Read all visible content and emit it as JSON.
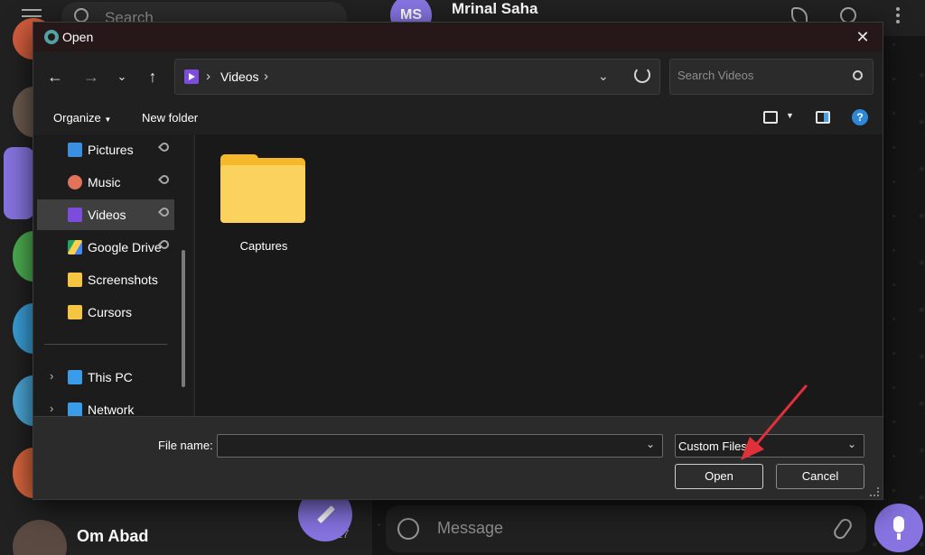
{
  "background_app": {
    "search_placeholder": "Search",
    "contact_initials": "MS",
    "contact_name": "Mrinal Saha",
    "last_chat_name": "Om Abad",
    "last_chat_count": "17",
    "message_placeholder": "Message",
    "accent_color": "#8774e1"
  },
  "dialog": {
    "title": "Open",
    "breadcrumb": [
      "Videos"
    ],
    "search_placeholder": "Search Videos",
    "commands": {
      "organize": "Organize",
      "new_folder": "New folder"
    },
    "help_glyph": "?",
    "sidebar": {
      "items": [
        {
          "label": "Pictures",
          "icon": "pictures-icon",
          "pinned": true
        },
        {
          "label": "Music",
          "icon": "music-icon",
          "pinned": true
        },
        {
          "label": "Videos",
          "icon": "videos-icon",
          "pinned": true,
          "selected": true
        },
        {
          "label": "Google Drive",
          "icon": "google-drive-icon",
          "pinned": true
        },
        {
          "label": "Screenshots",
          "icon": "folder-icon",
          "pinned": false
        },
        {
          "label": "Cursors",
          "icon": "folder-icon",
          "pinned": false
        },
        {
          "label": "This PC",
          "icon": "this-pc-icon",
          "expandable": true
        },
        {
          "label": "Network",
          "icon": "network-icon",
          "expandable": true
        }
      ]
    },
    "content": {
      "items": [
        {
          "name": "Captures",
          "type": "folder"
        }
      ]
    },
    "footer": {
      "file_name_label": "File name:",
      "file_name_value": "",
      "file_type": "Custom Files",
      "open_label": "Open",
      "cancel_label": "Cancel"
    },
    "annotation_color": "#e0303a"
  }
}
